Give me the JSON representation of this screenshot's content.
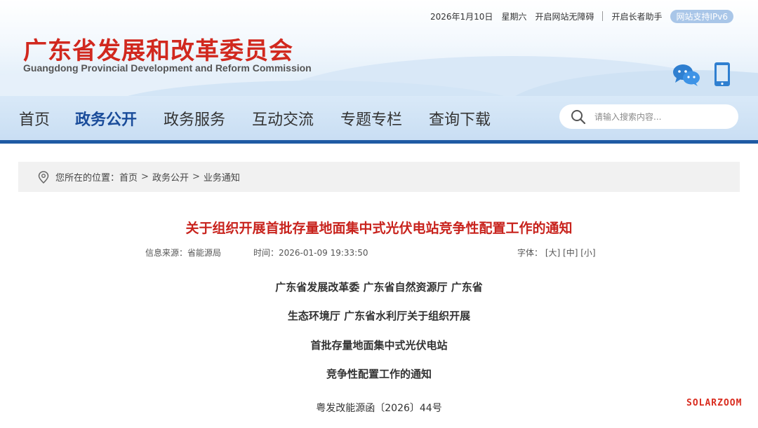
{
  "topbar": {
    "date": "2026年1月10日",
    "weekday": "星期六",
    "accessibility_link": "开启网站无障碍",
    "elderly_link": "开启长者助手",
    "ipv6_badge": "网站支持IPv6"
  },
  "site": {
    "name_cn": "广东省发展和改革委员会",
    "name_en": "Guangdong Provincial Development and Reform Commission"
  },
  "nav": {
    "items": [
      {
        "label": "首页"
      },
      {
        "label": "政务公开"
      },
      {
        "label": "政务服务"
      },
      {
        "label": "互动交流"
      },
      {
        "label": "专题专栏"
      },
      {
        "label": "查询下载"
      }
    ],
    "active_index": 1,
    "search_placeholder": "请输入搜索内容..."
  },
  "breadcrumb": {
    "prefix": "您所在的位置：",
    "items": [
      "首页",
      "政务公开",
      "业务通知"
    ],
    "separator": ">"
  },
  "article": {
    "title": "关于组织开展首批存量地面集中式光伏电站竞争性配置工作的通知",
    "source_label": "信息来源：",
    "source": "省能源局",
    "time_label": "时间：",
    "time": "2026-01-09 19:33:50",
    "font_label": "字体：",
    "font_sizes": [
      "[大]",
      "[中]",
      "[小]"
    ],
    "heading_lines": [
      "广东省发展改革委 广东省自然资源厅 广东省",
      "生态环境厅 广东省水利厅关于组织开展",
      "首批存量地面集中式光伏电站",
      "竞争性配置工作的通知"
    ],
    "doc_number": "粤发改能源函〔2026〕44号"
  },
  "watermark": "SOLARZOOM",
  "colors": {
    "brand_red": "#d1281e",
    "nav_blue": "#1f5aa3",
    "nav_active": "#1a4c9a",
    "title_red": "#c8231d"
  }
}
